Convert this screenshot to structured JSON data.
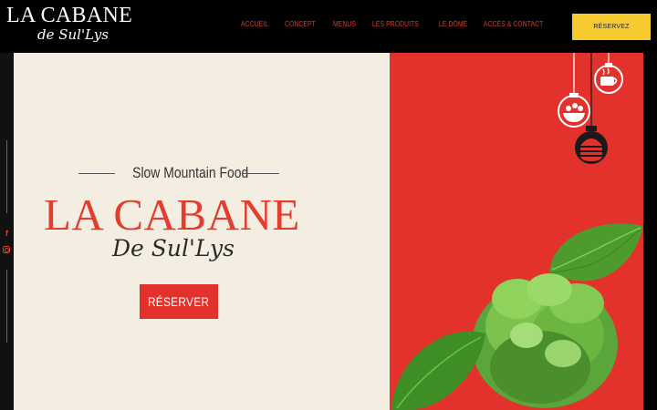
{
  "header": {
    "logo_main": "LA CABANE",
    "logo_sub": "de Sul'Lys",
    "nav": [
      "ACCUEIL",
      "CONCEPT",
      "MENUS",
      "LES PRODUITS",
      "LE DÔME",
      "ACCÈS & CONTACT"
    ],
    "reserve_label": "RÉSERVEZ"
  },
  "sidebar": {
    "icons": [
      "facebook-icon",
      "instagram-icon"
    ]
  },
  "hero": {
    "tagline": "Slow Mountain Food",
    "title": "LA CABANE",
    "subtitle": "De Sul'Lys",
    "reserve_label": "RÉSERVER"
  },
  "colors": {
    "accent_red": "#e3322b",
    "cream": "#f4eee2",
    "button_yellow": "#f7cb2f",
    "header_black": "#000000"
  }
}
